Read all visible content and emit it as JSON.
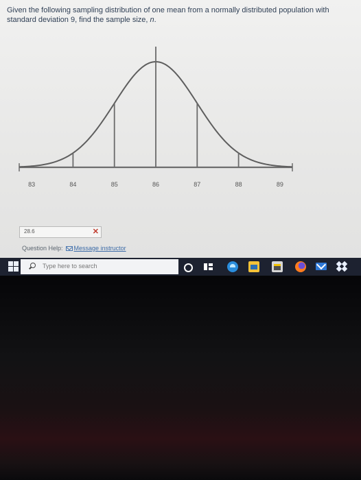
{
  "question": {
    "text": "Given the following sampling distribution of one mean from a normally distributed population with standard deviation 9, find the sample size,",
    "variable": "n",
    "suffix": "."
  },
  "chart_data": {
    "type": "line",
    "title": "",
    "xlabel": "",
    "ylabel": "",
    "x_ticks": [
      83,
      84,
      85,
      86,
      87,
      88,
      89
    ],
    "mean": 86,
    "standard_error": 1,
    "xlim": [
      82.7,
      89.3
    ],
    "grid": false
  },
  "answer": {
    "value": "28.6"
  },
  "help": {
    "label": "Question Help:",
    "link": "Message instructor"
  },
  "taskbar": {
    "search_placeholder": "Type here to search",
    "icons": [
      "windows-start-icon",
      "search-icon",
      "cortana-icon",
      "task-view-icon",
      "edge-icon",
      "file-explorer-icon",
      "store-icon",
      "firefox-icon",
      "mail-icon",
      "dropbox-icon"
    ]
  },
  "colors": {
    "question_text": "#2f3f55",
    "link": "#3d6ca8",
    "clear": "#c0392b",
    "taskbar": "#1d2230"
  }
}
